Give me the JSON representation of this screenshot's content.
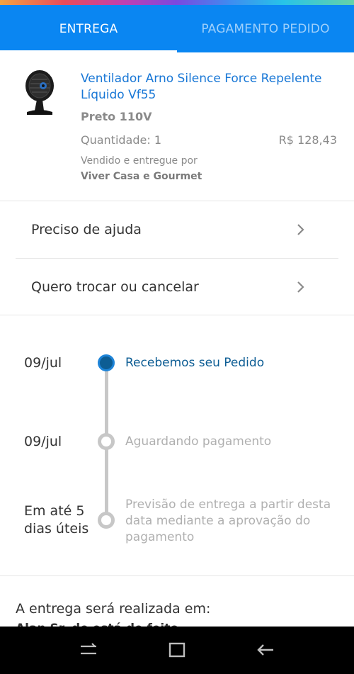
{
  "tabs": [
    {
      "label": "ENTREGA",
      "active": true
    },
    {
      "label": "PAGAMENTO PEDIDO",
      "active": false
    }
  ],
  "product": {
    "image_icon": "desk-fan-icon",
    "title": "Ventilador Arno Silence Force Repelente Líquido Vf55",
    "variant": "Preto 110V",
    "quantity": "Quantidade: 1",
    "price": "R$ 128,43",
    "sold_by_label": "Vendido e entregue por",
    "seller": "Viver Casa e Gourmet"
  },
  "menu": [
    {
      "label": "Preciso de ajuda",
      "icon": "chevron-right-icon"
    },
    {
      "label": "Quero trocar ou cancelar",
      "icon": "chevron-right-icon"
    }
  ],
  "timeline": [
    {
      "date": "09/jul",
      "status": "Recebemos seu Pedido",
      "active": true
    },
    {
      "date": "09/jul",
      "status": "Aguardando pagamento",
      "active": false
    },
    {
      "date": "Em até 5 dias úteis",
      "status": "Previsão de entrega a partir desta data mediante a aprovação do pagamento",
      "active": false
    }
  ],
  "delivery": {
    "label": "A entrega será realizada em:",
    "address_peek": "Alan Sr. de está de feito"
  },
  "colors": {
    "brand_blue": "#0a86f2",
    "link_blue": "#1877d6",
    "active_step": "#0d5d94",
    "inactive": "#c7c7c7"
  },
  "system_nav": [
    "recent-apps-icon",
    "home-icon",
    "back-icon"
  ]
}
